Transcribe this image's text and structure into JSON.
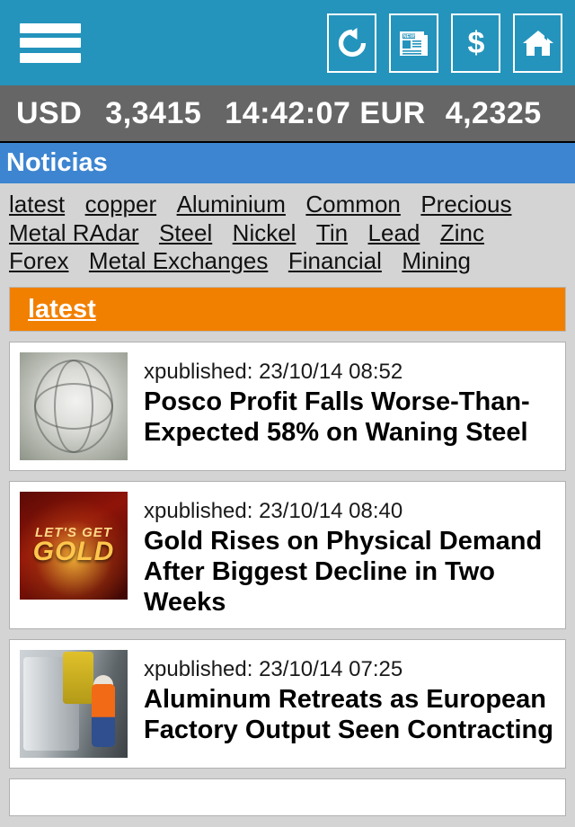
{
  "appbar": {
    "menu_label": "Menu",
    "actions": [
      {
        "name": "refresh-button",
        "icon": "refresh-icon",
        "label": "Refresh"
      },
      {
        "name": "news-button",
        "icon": "newspaper-icon",
        "label": "News"
      },
      {
        "name": "currency-button",
        "icon": "dollar-icon",
        "label": "Currency"
      },
      {
        "name": "home-button",
        "icon": "home-icon",
        "label": "Home"
      }
    ],
    "newspaper_masthead": "NEWS"
  },
  "ticker": {
    "usd_label": "USD",
    "usd_value": "3,3415",
    "time": "14:42:07",
    "eur_label": "EUR",
    "eur_value": "4,2325"
  },
  "section": {
    "title": "Noticias"
  },
  "nav": {
    "items": [
      "latest",
      "copper",
      "Aluminium",
      "Common",
      "Precious",
      "Metal RAdar",
      "Steel",
      "Nickel",
      "Tin",
      "Lead",
      "Zinc",
      "Forex",
      "Metal Exchanges",
      "Financial",
      "Mining"
    ]
  },
  "active_category": {
    "label": "latest"
  },
  "news": [
    {
      "published": "xpublished: 23/10/14 08:52",
      "headline": "Posco Profit Falls Worse-Than-Expected 58% on Waning Steel",
      "thumb_alt": "Posco steel globe sculpture",
      "thumb_style": "posco"
    },
    {
      "published": "xpublished: 23/10/14 08:40",
      "headline": "Gold Rises on Physical Demand After Biggest Decline in Two Weeks",
      "thumb_alt": "Let's Get Gold graphic",
      "thumb_style": "gold",
      "thumb_text_1": "LET'S GET",
      "thumb_text_2": "GOLD"
    },
    {
      "published": "xpublished: 23/10/14 07:25",
      "headline": "Aluminum Retreats as European Factory Output Seen Contracting",
      "thumb_alt": "Worker at aluminium factory line",
      "thumb_style": "factory"
    }
  ],
  "colors": {
    "appbar": "#2494bd",
    "ticker": "#666666",
    "section": "#3d85d0",
    "accent_orange": "#f28000",
    "page_bg": "#d4d4d4",
    "card_bg": "#ffffff"
  }
}
